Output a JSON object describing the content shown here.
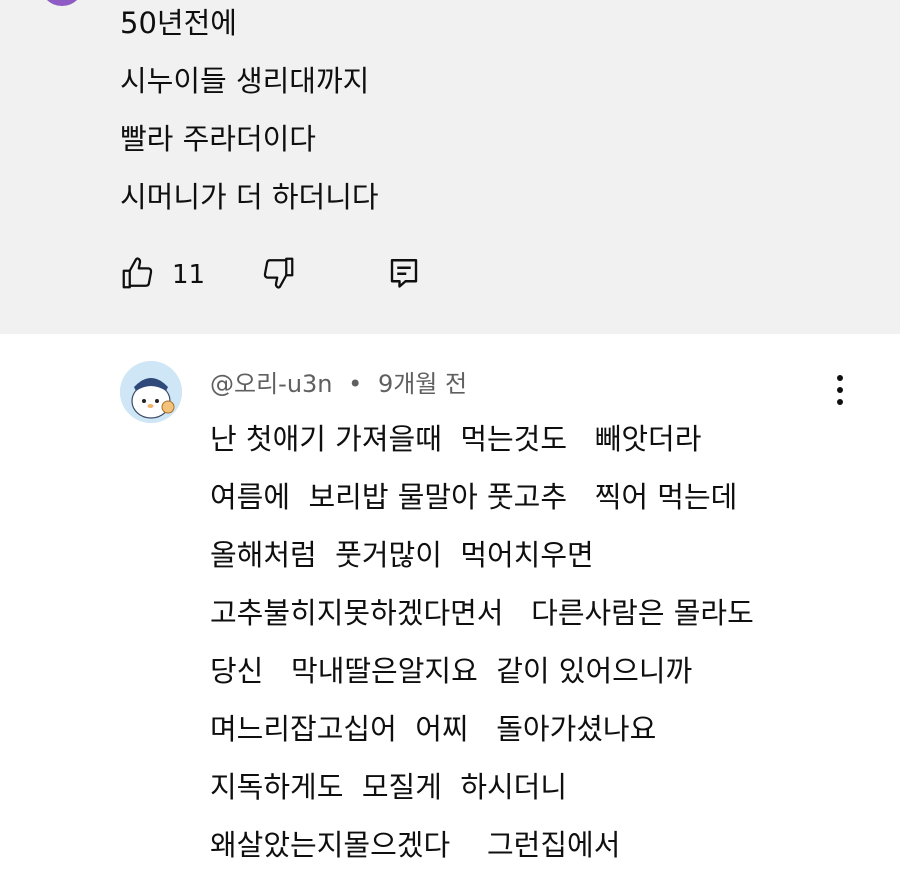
{
  "prev_comment": {
    "lines": [
      "50년전에",
      "시누이들 생리대까지",
      "빨라 주라더이다",
      "시머니가 더 하더니다"
    ],
    "like_count": "11",
    "icons": {
      "like": "thumbs-up-icon",
      "dislike": "thumbs-down-icon",
      "reply": "reply-icon"
    }
  },
  "comment": {
    "author": "@오리-u3n",
    "separator": "•",
    "time": "9개월 전",
    "lines": [
      "난 첫애기 가져을때  먹는것도   빼앗더라",
      "여름에  보리밥 물말아 풋고추   찍어 먹는데",
      "올해처럼  풋거많이  먹어치우면",
      "고추불히지못하겠다면서   다른사람은 몰라도",
      "당신   막내딸은알지요  같이 있어으니까",
      "며느리잡고십어  어찌   돌아가셨나요",
      "지독하게도  모질게  하시더니",
      "왜살았는지몰으겠다    그런집에서"
    ],
    "icons": {
      "more": "more-vertical-icon",
      "avatar": "avatar-image"
    }
  },
  "colors": {
    "prev_background": "#f1f1f1",
    "text": "#0f0f0f",
    "meta_text": "#606060",
    "prev_avatar": "#8e5cc4"
  }
}
